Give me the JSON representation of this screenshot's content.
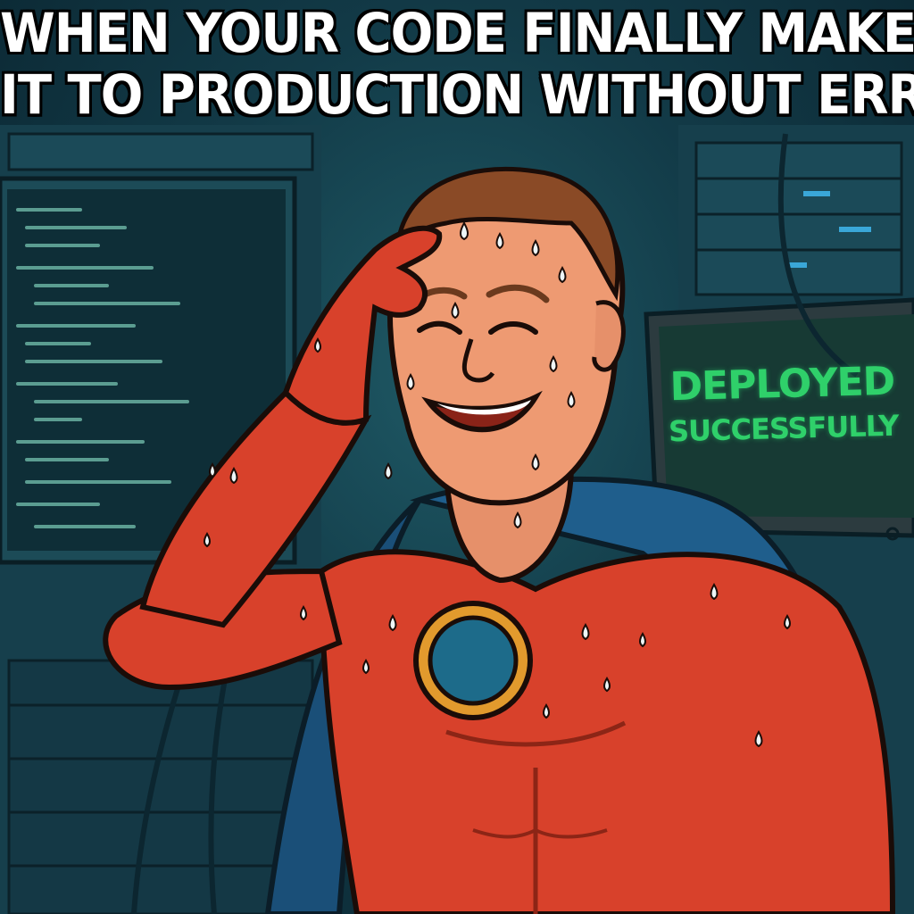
{
  "caption": {
    "line1": "WHEN YOUR CODE FINALLY MAKES",
    "line2": "IT TO PRODUCTION WITHOUT ERRORS"
  },
  "monitor": {
    "line1": "DEPLOYED",
    "line2": "SUCCESSFULLY"
  },
  "colors": {
    "caption_text": "#ffffff",
    "caption_outline": "#000000",
    "monitor_text": "#2fd06a",
    "suit": "#d8412b",
    "cape": "#1f5e8c",
    "emblem_ring": "#e29a2d",
    "emblem_center": "#1d6b8a",
    "background": "#123a47"
  }
}
